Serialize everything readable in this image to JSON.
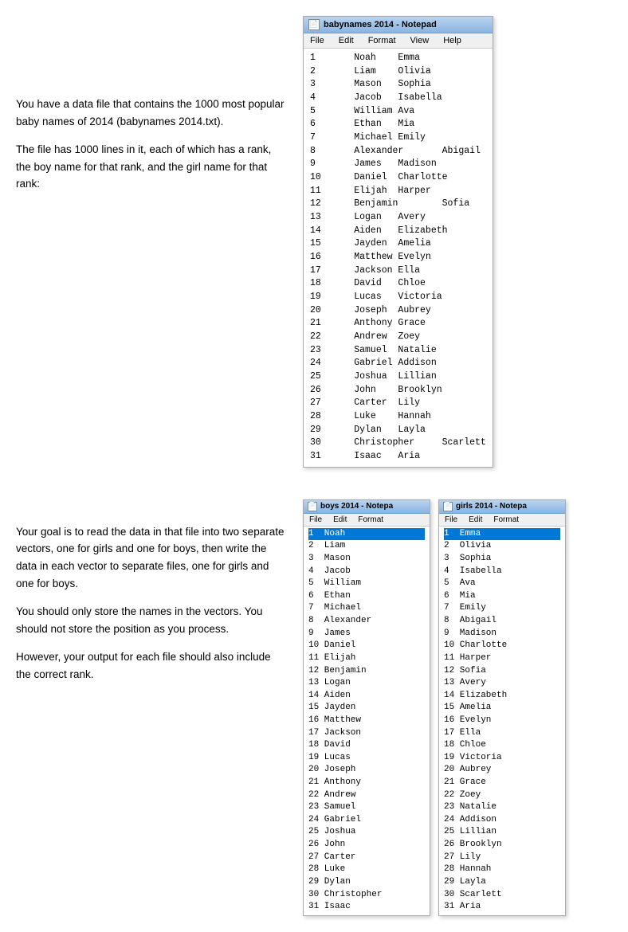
{
  "top_text": {
    "para1": "You have a data file that contains the 1000 most popular baby names of 2014 (babynames 2014.txt).",
    "para2": "The file has 1000 lines in it, each of which has a rank, the boy name for that rank, and the girl name for that rank:"
  },
  "bottom_text": {
    "para1": "Your goal is to read the data in that file into two separate vectors, one for girls and one for boys, then write the data in each vector to separate files, one for girls and one for boys.",
    "para2": "You should only store the names in the vectors.  You should not store the position as you process.",
    "para3": "However, your output for each file should also include the correct rank."
  },
  "main_notepad": {
    "title": "babynames 2014 - Notepad",
    "menus": [
      "File",
      "Edit",
      "Format",
      "View",
      "Help"
    ],
    "rows": [
      "1       Noah    Emma",
      "2       Liam    Olivia",
      "3       Mason   Sophia",
      "4       Jacob   Isabella",
      "5       William Ava",
      "6       Ethan   Mia",
      "7       Michael Emily",
      "8       Alexander       Abigail",
      "9       James   Madison",
      "10      Daniel  Charlotte",
      "11      Elijah  Harper",
      "12      Benjamin        Sofia",
      "13      Logan   Avery",
      "14      Aiden   Elizabeth",
      "15      Jayden  Amelia",
      "16      Matthew Evelyn",
      "17      Jackson Ella",
      "18      David   Chloe",
      "19      Lucas   Victoria",
      "20      Joseph  Aubrey",
      "21      Anthony Grace",
      "22      Andrew  Zoey",
      "23      Samuel  Natalie",
      "24      Gabriel Addison",
      "25      Joshua  Lillian",
      "26      John    Brooklyn",
      "27      Carter  Lily",
      "28      Luke    Hannah",
      "29      Dylan   Layla",
      "30      Christopher     Scarlett",
      "31      Isaac   Aria"
    ]
  },
  "boys_notepad": {
    "title": "boys 2014 - Notepa",
    "menus": [
      "File",
      "Edit",
      "Format"
    ],
    "rows": [
      "1  Noah",
      "2  Liam",
      "3  Mason",
      "4  Jacob",
      "5  William",
      "6  Ethan",
      "7  Michael",
      "8  Alexander",
      "9  James",
      "10 Daniel",
      "11 Elijah",
      "12 Benjamin",
      "13 Logan",
      "14 Aiden",
      "15 Jayden",
      "16 Matthew",
      "17 Jackson",
      "18 David",
      "19 Lucas",
      "20 Joseph",
      "21 Anthony",
      "22 Andrew",
      "23 Samuel",
      "24 Gabriel",
      "25 Joshua",
      "26 John",
      "27 Carter",
      "28 Luke",
      "29 Dylan",
      "30 Christopher",
      "31 Isaac"
    ]
  },
  "girls_notepad": {
    "title": "girls 2014 - Notepa",
    "menus": [
      "File",
      "Edit",
      "Format"
    ],
    "rows": [
      "1  Emma",
      "2  Olivia",
      "3  Sophia",
      "4  Isabella",
      "5  Ava",
      "6  Mia",
      "7  Emily",
      "8  Abigail",
      "9  Madison",
      "10 Charlotte",
      "11 Harper",
      "12 Sofia",
      "13 Avery",
      "14 Elizabeth",
      "15 Amelia",
      "16 Evelyn",
      "17 Ella",
      "18 Chloe",
      "19 Victoria",
      "20 Aubrey",
      "21 Grace",
      "22 Zoey",
      "23 Natalie",
      "24 Addison",
      "25 Lillian",
      "26 Brooklyn",
      "27 Lily",
      "28 Hannah",
      "29 Layla",
      "30 Scarlett",
      "31 Aria"
    ]
  }
}
